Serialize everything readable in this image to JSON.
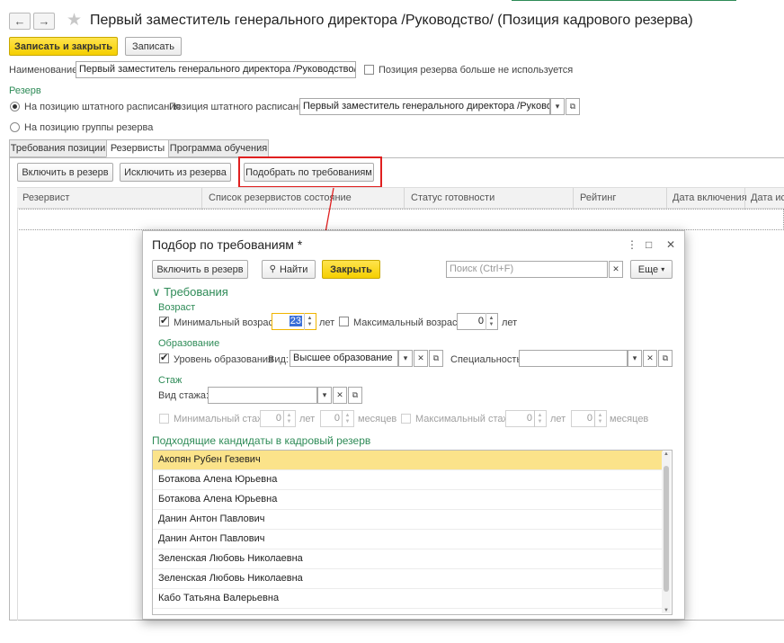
{
  "window": {
    "title": "Первый заместитель генерального директора /Руководство/ (Позиция кадрового резерва)"
  },
  "toolbar": {
    "save_close": "Записать и закрыть",
    "save": "Записать"
  },
  "form": {
    "name_label": "Наименование:",
    "name_value": "Первый заместитель генерального директора /Руководство/",
    "unused_label": "Позиция резерва больше не используется",
    "reserve_header": "Резерв",
    "radio_staff": "На позицию штатного расписания",
    "staff_position_label": "Позиция штатного расписания:",
    "staff_position_value": "Первый заместитель генерального директора /Руководство/",
    "radio_group": "На позицию группы резерва"
  },
  "tabs": [
    "Требования позиции",
    "Резервисты",
    "Программа обучения"
  ],
  "tab_buttons": {
    "include": "Включить в резерв",
    "exclude": "Исключить из резерва",
    "select": "Подобрать по требованиям"
  },
  "grid": {
    "columns": [
      "Резервист",
      "Список резервистов состояние",
      "Статус готовности",
      "Рейтинг",
      "Дата включения",
      "Дата иск"
    ]
  },
  "dialog": {
    "title": "Подбор по требованиям *",
    "btn_include": "Включить в резерв",
    "btn_find": "Найти",
    "btn_close": "Закрыть",
    "search_placeholder": "Поиск (Ctrl+F)",
    "more": "Еще",
    "requirements": "Требования",
    "age_header": "Возраст",
    "min_age_label": "Минимальный возраст",
    "min_age_value": "23",
    "years": "лет",
    "max_age_label": "Максимальный возраст",
    "max_age_value": "0",
    "education_header": "Образование",
    "edu_level_label": "Уровень образования",
    "kind_label": "Вид:",
    "kind_value": "Высшее образование",
    "specialty_label": "Специальность:",
    "experience_header": "Стаж",
    "exp_kind_label": "Вид стажа:",
    "min_exp_label": "Минимальный стаж",
    "max_exp_label": "Максимальный стаж",
    "zero": "0",
    "months": "месяцев",
    "candidates_header": "Подходящие кандидаты в кадровый резерв",
    "candidates": [
      "Акопян Рубен Гезевич",
      "Ботакова Алена Юрьевна",
      "Ботакова Алена Юрьевна",
      "Данин Антон Павлович",
      "Данин Антон Павлович",
      "Зеленская Любовь Николаевна",
      "Зеленская Любовь Николаевна",
      "Кабо Татьяна Валерьевна"
    ]
  },
  "colors": {
    "accent_green": "#2e8b57",
    "button_yellow": "#f5cf00",
    "highlight_red": "#e02020",
    "selected_row": "#fbe38a"
  },
  "icons": [
    "back-arrow-icon",
    "forward-arrow-icon",
    "star-icon",
    "dropdown-icon",
    "open-icon",
    "clear-icon",
    "search-icon",
    "menu-dots-icon",
    "maximize-icon",
    "close-icon",
    "chevron-down-icon"
  ]
}
